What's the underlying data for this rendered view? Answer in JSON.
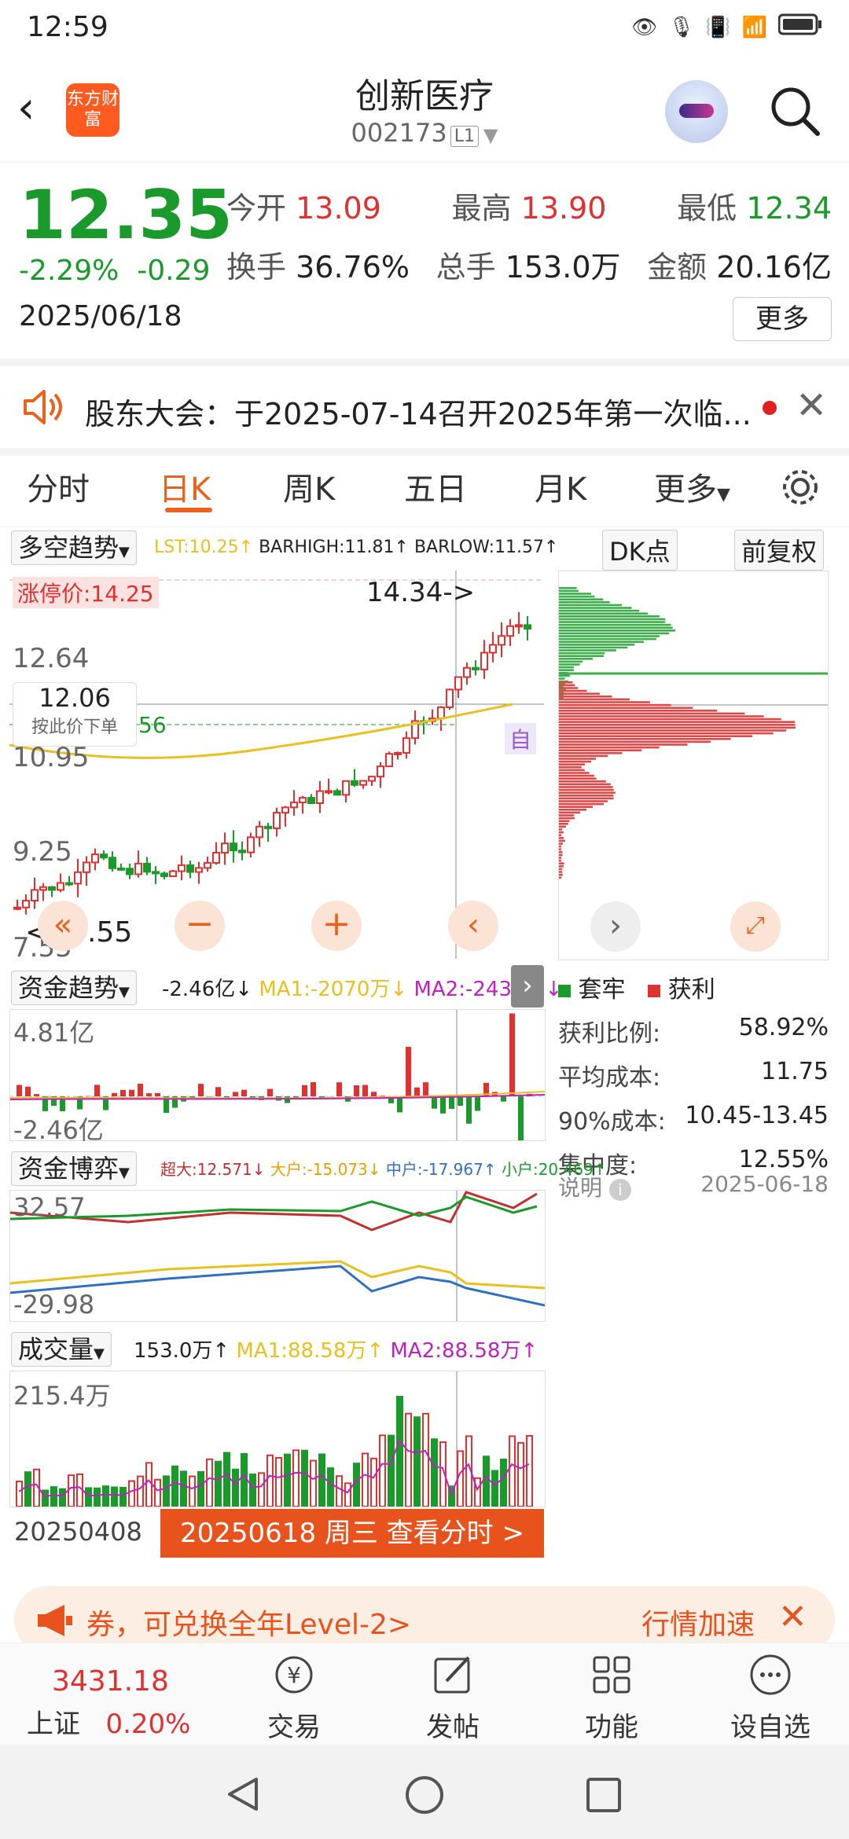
{
  "status": {
    "time": "12:59",
    "icons": [
      "eye-icon",
      "mic-icon",
      "vibrate-icon",
      "wifi-icon",
      "4g-signal-icon",
      "4g-signal-icon",
      "battery-icon"
    ]
  },
  "header": {
    "logo": "东方财富",
    "title": "创新医疗",
    "code": "002173",
    "level": "L1"
  },
  "quote": {
    "price": "12.35",
    "pct": "-2.29%",
    "chg": "-0.29",
    "date": "2025/06/18",
    "rows": [
      [
        {
          "l": "今开",
          "v": "13.09",
          "c": "red"
        },
        {
          "l": "最高",
          "v": "13.90",
          "c": "red"
        },
        {
          "l": "最低",
          "v": "12.34",
          "c": "green"
        }
      ],
      [
        {
          "l": "换手",
          "v": "36.76%",
          "c": ""
        },
        {
          "l": "总手",
          "v": "153.0万",
          "c": ""
        },
        {
          "l": "金额",
          "v": "20.16亿",
          "c": ""
        }
      ]
    ],
    "more": "更多"
  },
  "notice": {
    "text": "股东大会：于2025-07-14召开2025年第一次临..."
  },
  "tabs": [
    "分时",
    "日K",
    "周K",
    "五日",
    "月K",
    "更多"
  ],
  "kline": {
    "indicator": "多空趋势",
    "lst": "LST:10.25↑",
    "barhigh": "BARHIGH:11.81↑",
    "barlow": "BARLOW:11.57↑",
    "dk": "DK点",
    "fq": "前复权",
    "limit": "涨停价:14.25",
    "top_label": "14.34->",
    "y1": "12.64",
    "y2": "10.95",
    "y3": "9.25",
    "y4": "7.55",
    "bottom_label": "<--7.55",
    "cross_price": "12.06",
    "cross_hint": "按此价下单",
    "auto": "自",
    "left_num": "56"
  },
  "chips": {
    "legend_a": "套牢",
    "legend_b": "获利",
    "rows": [
      {
        "l": "获利比例:",
        "v": "58.92%"
      },
      {
        "l": "平均成本:",
        "v": "11.75"
      },
      {
        "l": "90%成本:",
        "v": "10.45-13.45"
      },
      {
        "l": "集中度:",
        "v": "12.55%"
      }
    ],
    "note": "说明",
    "note_date": "2025-06-18"
  },
  "fund": {
    "name": "资金趋势",
    "val": "-2.46亿↓",
    "ma1": "MA1:-2070万↓",
    "ma2": "MA2:-2434万↓",
    "top": "4.81亿",
    "bottom": "-2.46亿"
  },
  "game": {
    "name": "资金博弈",
    "items": [
      "超大:12.571↓",
      "大户:-15.073↓",
      "中户:-17.967↑",
      "小户:20.469↑"
    ],
    "top": "32.57",
    "bottom": "-29.98"
  },
  "vol": {
    "name": "成交量",
    "val": "153.0万↑",
    "ma1": "MA1:88.58万↑",
    "ma2": "MA2:88.58万↑",
    "top": "215.4万",
    "start": "20250408",
    "pill": "20250618 周三 查看分时 >"
  },
  "banner": {
    "text": "券，可兑换全年Level-2>",
    "right": "行情加速"
  },
  "nav": {
    "index_name": "上证",
    "index_val": "3431.18",
    "index_pct": "0.20%",
    "items": [
      "交易",
      "发帖",
      "功能",
      "设自选"
    ]
  },
  "colors": {
    "up": "#e03030",
    "down": "#1a9a2b",
    "accent": "#e8621c"
  }
}
